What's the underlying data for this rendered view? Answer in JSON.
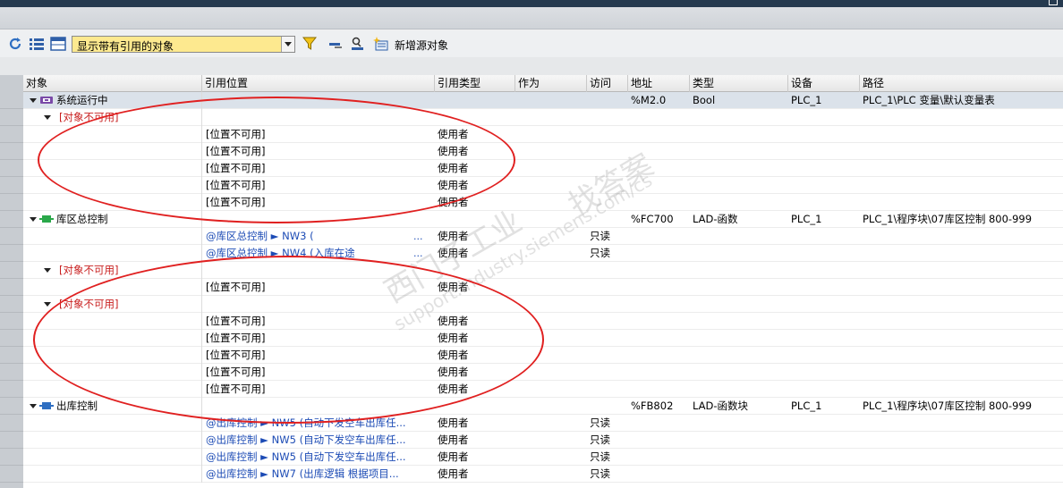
{
  "window": {
    "title": ""
  },
  "toolbar": {
    "filter_value": "显示带有引用的对象",
    "add_source_label": "新增源对象"
  },
  "columns": [
    "对象",
    "引用位置",
    "引用类型",
    "作为",
    "访问",
    "地址",
    "类型",
    "设备",
    "路径"
  ],
  "rows": [
    {
      "kind": "object",
      "obj": "系统运行中",
      "icon": "tag-icon",
      "addr": "%M2.0",
      "type": "Bool",
      "device": "PLC_1",
      "path": "PLC_1\\PLC 变量\\默认变量表",
      "selected": true
    },
    {
      "kind": "unavail",
      "obj": "[对象不可用]"
    },
    {
      "kind": "ref",
      "loc": "[位置不可用]",
      "reftype": "使用者"
    },
    {
      "kind": "ref",
      "loc": "[位置不可用]",
      "reftype": "使用者"
    },
    {
      "kind": "ref",
      "loc": "[位置不可用]",
      "reftype": "使用者"
    },
    {
      "kind": "ref",
      "loc": "[位置不可用]",
      "reftype": "使用者"
    },
    {
      "kind": "ref",
      "loc": "[位置不可用]",
      "reftype": "使用者"
    },
    {
      "kind": "object",
      "obj": "库区总控制",
      "icon": "fc-block-icon",
      "addr": "%FC700",
      "type": "LAD-函数",
      "device": "PLC_1",
      "path": "PLC_1\\程序块\\07库区控制 800-999"
    },
    {
      "kind": "link",
      "loc": "@库区总控制 ► NW3 (",
      "more": "...",
      "reftype": "使用者",
      "access": "只读"
    },
    {
      "kind": "link",
      "loc": "@库区总控制 ► NW4 (入库在途",
      "more": "...",
      "reftype": "使用者",
      "access": "只读"
    },
    {
      "kind": "unavail",
      "obj": "[对象不可用]"
    },
    {
      "kind": "ref",
      "loc": "[位置不可用]",
      "reftype": "使用者"
    },
    {
      "kind": "unavail",
      "obj": "[对象不可用]"
    },
    {
      "kind": "ref",
      "loc": "[位置不可用]",
      "reftype": "使用者"
    },
    {
      "kind": "ref",
      "loc": "[位置不可用]",
      "reftype": "使用者"
    },
    {
      "kind": "ref",
      "loc": "[位置不可用]",
      "reftype": "使用者"
    },
    {
      "kind": "ref",
      "loc": "[位置不可用]",
      "reftype": "使用者"
    },
    {
      "kind": "ref",
      "loc": "[位置不可用]",
      "reftype": "使用者"
    },
    {
      "kind": "object",
      "obj": "出库控制",
      "icon": "fb-block-icon",
      "addr": "%FB802",
      "type": "LAD-函数块",
      "device": "PLC_1",
      "path": "PLC_1\\程序块\\07库区控制 800-999"
    },
    {
      "kind": "link",
      "loc": "@出库控制 ► NW5 (自动下发空车出库任...",
      "reftype": "使用者",
      "access": "只读"
    },
    {
      "kind": "link",
      "loc": "@出库控制 ► NW5 (自动下发空车出库任...",
      "reftype": "使用者",
      "access": "只读"
    },
    {
      "kind": "link",
      "loc": "@出库控制 ► NW5 (自动下发空车出库任...",
      "reftype": "使用者",
      "access": "只读"
    },
    {
      "kind": "link",
      "loc": "@出库控制 ► NW7 (出库逻辑   根据项目...",
      "reftype": "使用者",
      "access": "只读"
    }
  ],
  "watermark": {
    "line1": "西门子工业",
    "line2": "support.industry.siemens.com/cs",
    "line3": "找答案"
  },
  "colors": {
    "annotation": "#e02020",
    "link": "#1c4bb5",
    "unavailable": "#c81e1e",
    "filter_bg": "#fde98f"
  }
}
